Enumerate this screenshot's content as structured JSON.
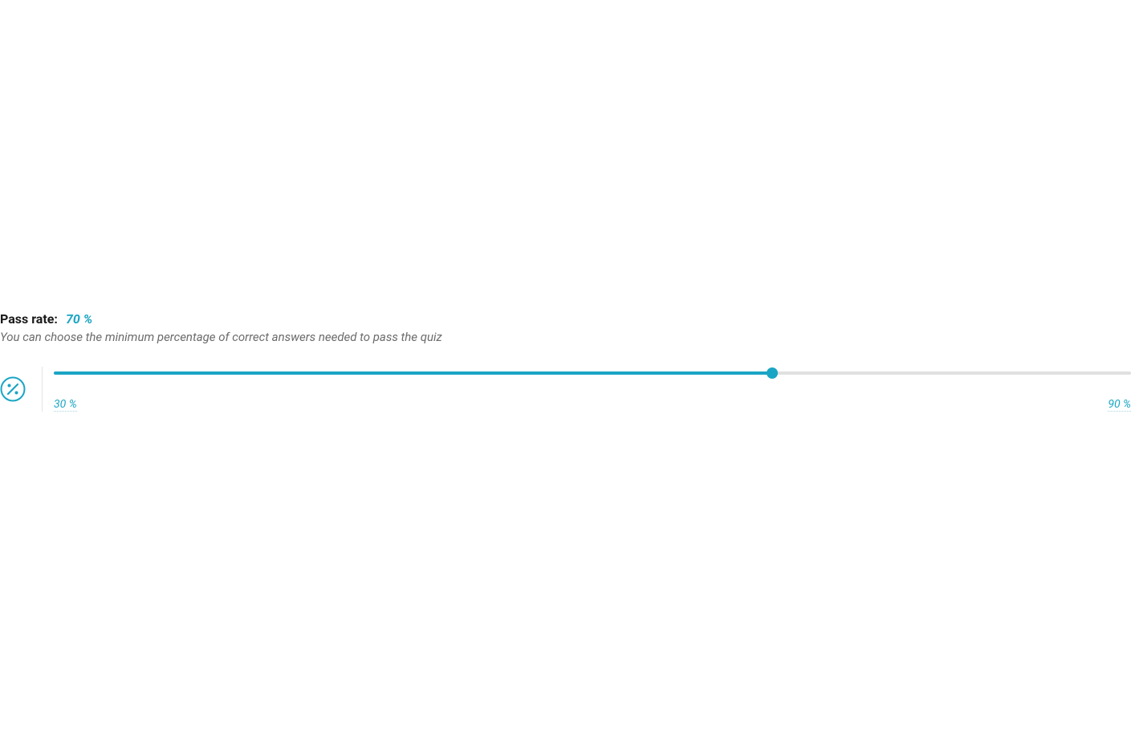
{
  "passRate": {
    "label": "Pass rate:",
    "value": "70 %",
    "description": "You can choose the minimum percentage of correct answers needed to pass the quiz",
    "slider": {
      "min": 30,
      "max": 90,
      "current": 70,
      "minLabel": "30 %",
      "maxLabel": "90 %"
    }
  },
  "colors": {
    "accent": "#1ba5c4",
    "textPrimary": "#1a1a1a",
    "textMuted": "#6b6b6b",
    "trackBg": "#e0e0e0"
  }
}
